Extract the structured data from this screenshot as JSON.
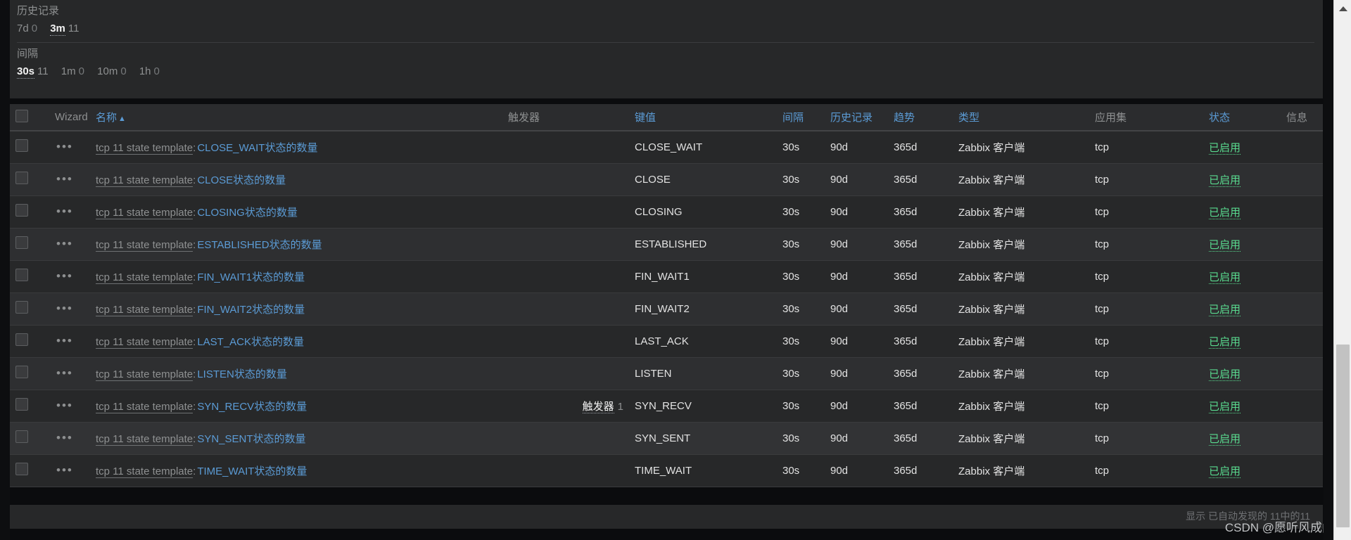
{
  "filters": [
    {
      "label": "历史记录",
      "options": [
        {
          "key": "7d",
          "count": "0",
          "active": false
        },
        {
          "key": "3m",
          "count": "11",
          "active": true
        }
      ]
    },
    {
      "label": "间隔",
      "options": [
        {
          "key": "30s",
          "count": "11",
          "active": true
        },
        {
          "key": "1m",
          "count": "0",
          "active": false
        },
        {
          "key": "10m",
          "count": "0",
          "active": false
        },
        {
          "key": "1h",
          "count": "0",
          "active": false
        }
      ]
    }
  ],
  "table": {
    "headers": {
      "checkbox": "",
      "wizard": "Wizard",
      "name": "名称",
      "sort_arrow": "▲",
      "triggers": "触发器",
      "key": "键值",
      "interval": "间隔",
      "history": "历史记录",
      "trends": "趋势",
      "type": "类型",
      "applications": "应用集",
      "status": "状态",
      "info": "信息"
    },
    "row_menu_icon": "•••",
    "rows": [
      {
        "template": "tcp 11 state template",
        "separator": ":",
        "item": "CLOSE_WAIT状态的数量",
        "triggers": "",
        "trigger_count": "",
        "key": "CLOSE_WAIT",
        "interval": "30s",
        "history": "90d",
        "trends": "365d",
        "type": "Zabbix 客户端",
        "applications": "tcp",
        "status": "已启用",
        "info": ""
      },
      {
        "template": "tcp 11 state template",
        "separator": ":",
        "item": "CLOSE状态的数量",
        "triggers": "",
        "trigger_count": "",
        "key": "CLOSE",
        "interval": "30s",
        "history": "90d",
        "trends": "365d",
        "type": "Zabbix 客户端",
        "applications": "tcp",
        "status": "已启用",
        "info": ""
      },
      {
        "template": "tcp 11 state template",
        "separator": ":",
        "item": "CLOSING状态的数量",
        "triggers": "",
        "trigger_count": "",
        "key": "CLOSING",
        "interval": "30s",
        "history": "90d",
        "trends": "365d",
        "type": "Zabbix 客户端",
        "applications": "tcp",
        "status": "已启用",
        "info": ""
      },
      {
        "template": "tcp 11 state template",
        "separator": ":",
        "item": "ESTABLISHED状态的数量",
        "triggers": "",
        "trigger_count": "",
        "key": "ESTABLISHED",
        "interval": "30s",
        "history": "90d",
        "trends": "365d",
        "type": "Zabbix 客户端",
        "applications": "tcp",
        "status": "已启用",
        "info": ""
      },
      {
        "template": "tcp 11 state template",
        "separator": ":",
        "item": "FIN_WAIT1状态的数量",
        "triggers": "",
        "trigger_count": "",
        "key": "FIN_WAIT1",
        "interval": "30s",
        "history": "90d",
        "trends": "365d",
        "type": "Zabbix 客户端",
        "applications": "tcp",
        "status": "已启用",
        "info": ""
      },
      {
        "template": "tcp 11 state template",
        "separator": ":",
        "item": "FIN_WAIT2状态的数量",
        "triggers": "",
        "trigger_count": "",
        "key": "FIN_WAIT2",
        "interval": "30s",
        "history": "90d",
        "trends": "365d",
        "type": "Zabbix 客户端",
        "applications": "tcp",
        "status": "已启用",
        "info": ""
      },
      {
        "template": "tcp 11 state template",
        "separator": ":",
        "item": "LAST_ACK状态的数量",
        "triggers": "",
        "trigger_count": "",
        "key": "LAST_ACK",
        "interval": "30s",
        "history": "90d",
        "trends": "365d",
        "type": "Zabbix 客户端",
        "applications": "tcp",
        "status": "已启用",
        "info": ""
      },
      {
        "template": "tcp 11 state template",
        "separator": ":",
        "item": "LISTEN状态的数量",
        "triggers": "",
        "trigger_count": "",
        "key": "LISTEN",
        "interval": "30s",
        "history": "90d",
        "trends": "365d",
        "type": "Zabbix 客户端",
        "applications": "tcp",
        "status": "已启用",
        "info": ""
      },
      {
        "template": "tcp 11 state template",
        "separator": ":",
        "item": "SYN_RECV状态的数量",
        "triggers": "触发器",
        "trigger_count": "1",
        "key": "SYN_RECV",
        "interval": "30s",
        "history": "90d",
        "trends": "365d",
        "type": "Zabbix 客户端",
        "applications": "tcp",
        "status": "已启用",
        "info": ""
      },
      {
        "template": "tcp 11 state template",
        "separator": ":",
        "item": "SYN_SENT状态的数量",
        "triggers": "",
        "trigger_count": "",
        "key": "SYN_SENT",
        "interval": "30s",
        "history": "90d",
        "trends": "365d",
        "type": "Zabbix 客户端",
        "applications": "tcp",
        "status": "已启用",
        "info": ""
      },
      {
        "template": "tcp 11 state template",
        "separator": ":",
        "item": "TIME_WAIT状态的数量",
        "triggers": "",
        "trigger_count": "",
        "key": "TIME_WAIT",
        "interval": "30s",
        "history": "90d",
        "trends": "365d",
        "type": "Zabbix 客户端",
        "applications": "tcp",
        "status": "已启用",
        "info": ""
      }
    ],
    "footer": "显示 已自动发现的 11中的11"
  },
  "watermark": "CSDN @愿听风成曲",
  "colors": {
    "link": "#5b9bd5",
    "status_enabled": "#59db8f",
    "panel_bg": "#272829",
    "row_alt_bg": "#2e2f31"
  },
  "scrollbar": {
    "up_arrow_icon": "scroll-up-arrow"
  }
}
